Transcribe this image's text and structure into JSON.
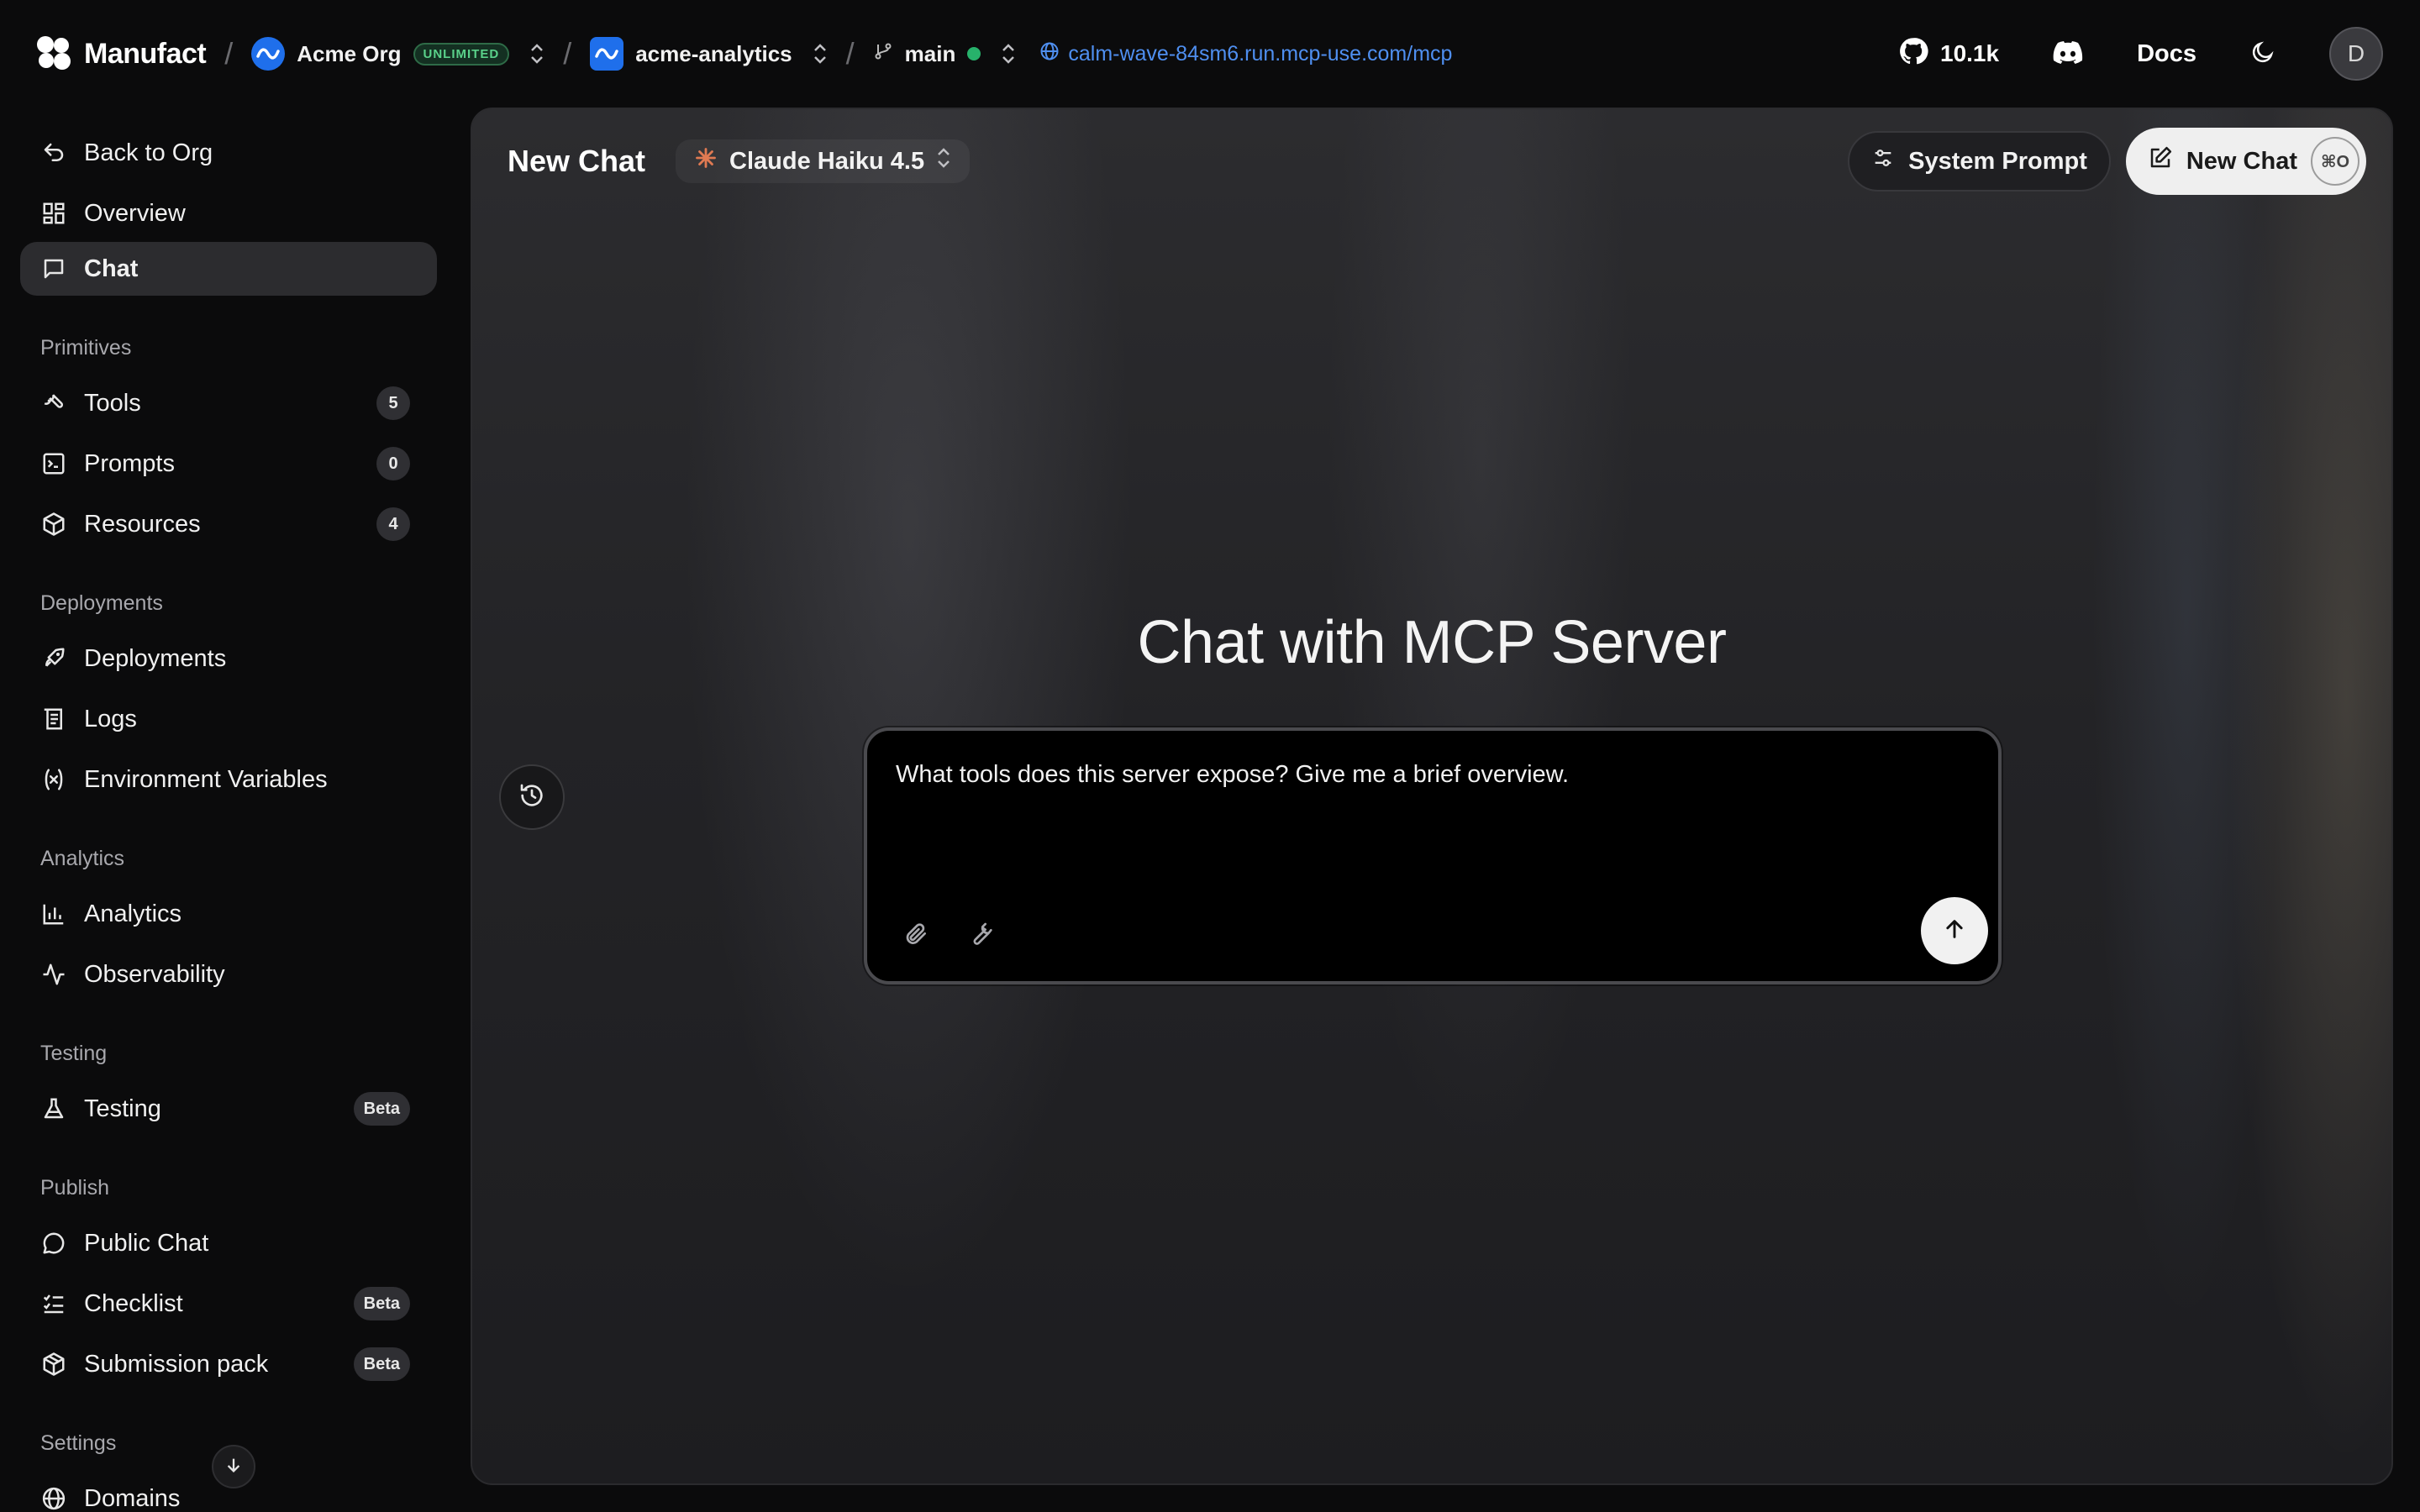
{
  "topbar": {
    "brand": "Manufact",
    "org": {
      "name": "Acme Org",
      "plan_badge": "UNLIMITED"
    },
    "project": {
      "name": "acme-analytics"
    },
    "branch": {
      "name": "main",
      "status_color": "#27b26b"
    },
    "server_url": "calm-wave-84sm6.run.mcp-use.com/mcp",
    "github_stars": "10.1k",
    "docs_label": "Docs",
    "avatar_initial": "D"
  },
  "sidebar": {
    "top_items": [
      {
        "label": "Back to Org",
        "icon": "back-arrow-icon"
      },
      {
        "label": "Overview",
        "icon": "grid-icon"
      },
      {
        "label": "Chat",
        "icon": "chat-icon",
        "active": true
      }
    ],
    "sections": [
      {
        "title": "Primitives",
        "items": [
          {
            "label": "Tools",
            "icon": "wrench-icon",
            "badge": "5"
          },
          {
            "label": "Prompts",
            "icon": "terminal-icon",
            "badge": "0"
          },
          {
            "label": "Resources",
            "icon": "cube-icon",
            "badge": "4"
          }
        ]
      },
      {
        "title": "Deployments",
        "items": [
          {
            "label": "Deployments",
            "icon": "rocket-icon"
          },
          {
            "label": "Logs",
            "icon": "logs-icon"
          },
          {
            "label": "Environment Variables",
            "icon": "variable-icon"
          }
        ]
      },
      {
        "title": "Analytics",
        "items": [
          {
            "label": "Analytics",
            "icon": "bar-chart-icon"
          },
          {
            "label": "Observability",
            "icon": "activity-icon"
          }
        ]
      },
      {
        "title": "Testing",
        "items": [
          {
            "label": "Testing",
            "icon": "flask-icon",
            "badge": "Beta"
          }
        ]
      },
      {
        "title": "Publish",
        "items": [
          {
            "label": "Public Chat",
            "icon": "chat-bubble-icon"
          },
          {
            "label": "Checklist",
            "icon": "checklist-icon",
            "badge": "Beta"
          },
          {
            "label": "Submission pack",
            "icon": "package-icon",
            "badge": "Beta"
          }
        ]
      },
      {
        "title": "Settings",
        "items": [
          {
            "label": "Domains",
            "icon": "globe-icon"
          }
        ]
      }
    ]
  },
  "main": {
    "title": "New Chat",
    "model_name": "Claude Haiku 4.5",
    "system_prompt_label": "System Prompt",
    "new_chat_label": "New Chat",
    "new_chat_shortcut": "⌘O",
    "hero_text": "Chat with MCP Server",
    "composer_value": "What tools does this server expose? Give me a brief overview."
  }
}
